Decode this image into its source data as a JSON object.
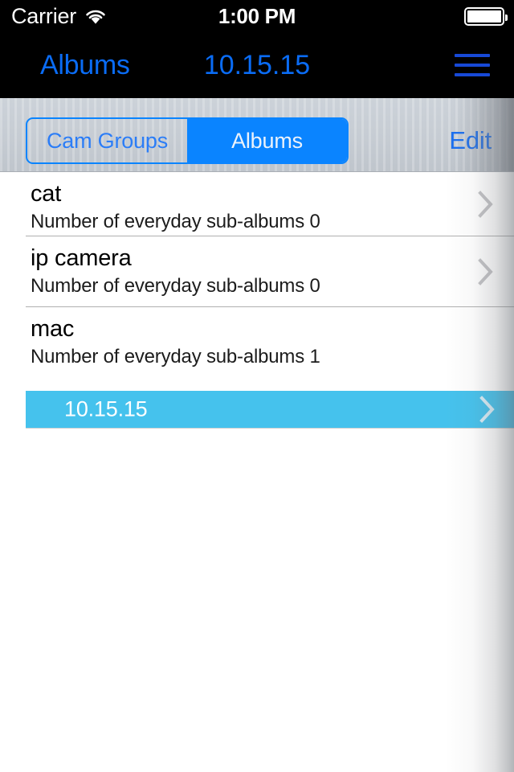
{
  "status_bar": {
    "carrier": "Carrier",
    "wifi_icon": "wifi-icon",
    "time": "1:00 PM",
    "battery_icon": "battery-full-icon"
  },
  "nav_bar": {
    "back_label": "Albums",
    "title": "10.15.15",
    "menu_icon": "hamburger-menu-icon",
    "accent_color": "#0a6cf5"
  },
  "toolbar": {
    "segmented_control": {
      "options": [
        {
          "label": "Cam Groups",
          "selected": false
        },
        {
          "label": "Albums",
          "selected": true
        }
      ],
      "selected_index": 1,
      "tint_color": "#0a84ff"
    },
    "edit_label": "Edit"
  },
  "list": {
    "rows": [
      {
        "title": "cat",
        "subtitle": "Number of everyday sub-albums 0",
        "chevron_icon": "chevron-right-icon",
        "sub_albums": []
      },
      {
        "title": "ip camera",
        "subtitle": "Number of everyday sub-albums 0",
        "chevron_icon": "chevron-right-icon",
        "sub_albums": []
      },
      {
        "title": "mac",
        "subtitle": "Number of everyday sub-albums 1",
        "chevron_icon": "chevron-right-icon",
        "sub_albums": [
          {
            "title": "10.15.15",
            "selected": true,
            "highlight_color": "#45c2ed",
            "chevron_icon": "chevron-right-icon"
          }
        ]
      }
    ]
  }
}
